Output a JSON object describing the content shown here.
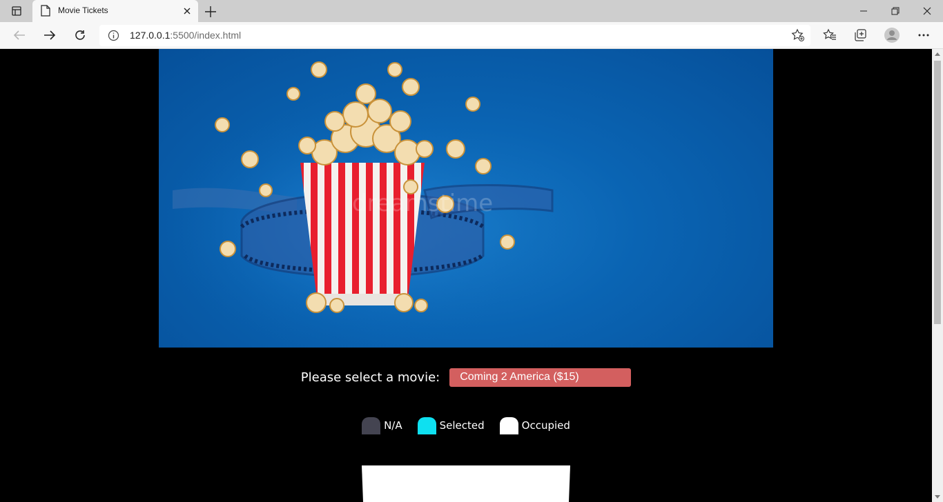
{
  "browser": {
    "tab_title": "Movie Tickets",
    "url_host": "127.0.0.1",
    "url_rest": ":5500/index.html"
  },
  "page": {
    "movie_prompt": "Please select a movie:",
    "movie_selected": "Coming 2 America ($15)",
    "legend": [
      {
        "label": "N/A",
        "color": "#444451"
      },
      {
        "label": "Selected",
        "color": "#0ee0f0"
      },
      {
        "label": "Occupied",
        "color": "#ffffff"
      }
    ],
    "hero_watermark": "dreamstime"
  },
  "colors": {
    "select_bg": "#d35f5f",
    "hero_blue": "#0a64b3"
  }
}
